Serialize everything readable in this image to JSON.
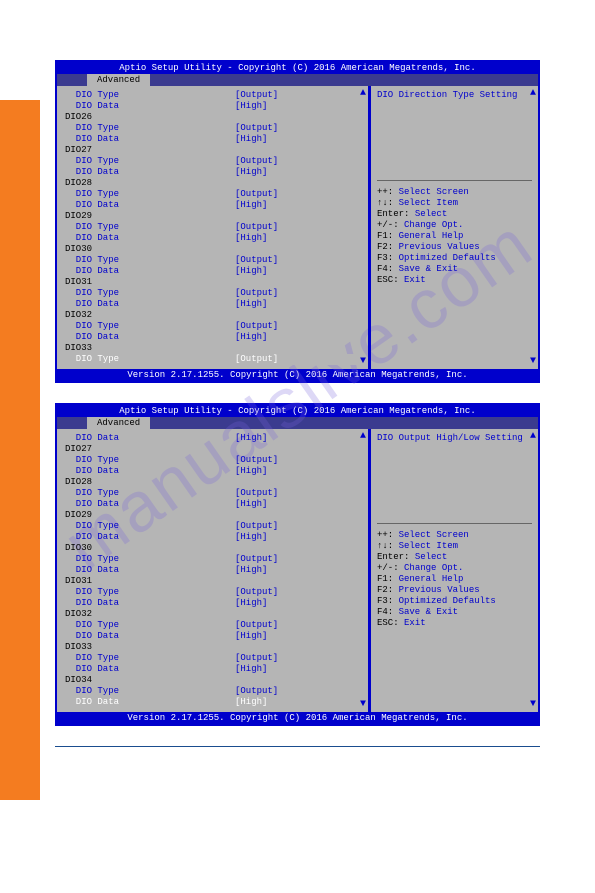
{
  "watermark": "manualslive.com",
  "title": "Aptio Setup Utility - Copyright (C) 2016 American Megatrends, Inc.",
  "tab": "Advanced",
  "footer": "Version 2.17.1255. Copyright (C) 2016 American Megatrends, Inc.",
  "panel1": {
    "help_title": "DIO Direction Type Setting",
    "rows": [
      {
        "t": "item",
        "label": "  DIO Type",
        "value": "[Output]",
        "hl": false
      },
      {
        "t": "item",
        "label": "  DIO Data",
        "value": "[High]",
        "hl": false
      },
      {
        "t": "group",
        "label": "DIO26"
      },
      {
        "t": "item",
        "label": "  DIO Type",
        "value": "[Output]",
        "hl": false
      },
      {
        "t": "item",
        "label": "  DIO Data",
        "value": "[High]",
        "hl": false
      },
      {
        "t": "group",
        "label": "DIO27"
      },
      {
        "t": "item",
        "label": "  DIO Type",
        "value": "[Output]",
        "hl": false
      },
      {
        "t": "item",
        "label": "  DIO Data",
        "value": "[High]",
        "hl": false
      },
      {
        "t": "group",
        "label": "DIO28"
      },
      {
        "t": "item",
        "label": "  DIO Type",
        "value": "[Output]",
        "hl": false
      },
      {
        "t": "item",
        "label": "  DIO Data",
        "value": "[High]",
        "hl": false
      },
      {
        "t": "group",
        "label": "DIO29"
      },
      {
        "t": "item",
        "label": "  DIO Type",
        "value": "[Output]",
        "hl": false
      },
      {
        "t": "item",
        "label": "  DIO Data",
        "value": "[High]",
        "hl": false
      },
      {
        "t": "group",
        "label": "DIO30"
      },
      {
        "t": "item",
        "label": "  DIO Type",
        "value": "[Output]",
        "hl": false
      },
      {
        "t": "item",
        "label": "  DIO Data",
        "value": "[High]",
        "hl": false
      },
      {
        "t": "group",
        "label": "DIO31"
      },
      {
        "t": "item",
        "label": "  DIO Type",
        "value": "[Output]",
        "hl": false
      },
      {
        "t": "item",
        "label": "  DIO Data",
        "value": "[High]",
        "hl": false
      },
      {
        "t": "group",
        "label": "DIO32"
      },
      {
        "t": "item",
        "label": "  DIO Type",
        "value": "[Output]",
        "hl": false
      },
      {
        "t": "item",
        "label": "  DIO Data",
        "value": "[High]",
        "hl": false
      },
      {
        "t": "group",
        "label": "DIO33"
      },
      {
        "t": "item",
        "label": "  DIO Type",
        "value": "[Output]",
        "hl": true
      }
    ]
  },
  "panel2": {
    "help_title": "DIO Output High/Low Setting",
    "rows": [
      {
        "t": "item",
        "label": "  DIO Data",
        "value": "[High]",
        "hl": false
      },
      {
        "t": "group",
        "label": "DIO27"
      },
      {
        "t": "item",
        "label": "  DIO Type",
        "value": "[Output]",
        "hl": false
      },
      {
        "t": "item",
        "label": "  DIO Data",
        "value": "[High]",
        "hl": false
      },
      {
        "t": "group",
        "label": "DIO28"
      },
      {
        "t": "item",
        "label": "  DIO Type",
        "value": "[Output]",
        "hl": false
      },
      {
        "t": "item",
        "label": "  DIO Data",
        "value": "[High]",
        "hl": false
      },
      {
        "t": "group",
        "label": "DIO29"
      },
      {
        "t": "item",
        "label": "  DIO Type",
        "value": "[Output]",
        "hl": false
      },
      {
        "t": "item",
        "label": "  DIO Data",
        "value": "[High]",
        "hl": false
      },
      {
        "t": "group",
        "label": "DIO30"
      },
      {
        "t": "item",
        "label": "  DIO Type",
        "value": "[Output]",
        "hl": false
      },
      {
        "t": "item",
        "label": "  DIO Data",
        "value": "[High]",
        "hl": false
      },
      {
        "t": "group",
        "label": "DIO31"
      },
      {
        "t": "item",
        "label": "  DIO Type",
        "value": "[Output]",
        "hl": false
      },
      {
        "t": "item",
        "label": "  DIO Data",
        "value": "[High]",
        "hl": false
      },
      {
        "t": "group",
        "label": "DIO32"
      },
      {
        "t": "item",
        "label": "  DIO Type",
        "value": "[Output]",
        "hl": false
      },
      {
        "t": "item",
        "label": "  DIO Data",
        "value": "[High]",
        "hl": false
      },
      {
        "t": "group",
        "label": "DIO33"
      },
      {
        "t": "item",
        "label": "  DIO Type",
        "value": "[Output]",
        "hl": false
      },
      {
        "t": "item",
        "label": "  DIO Data",
        "value": "[High]",
        "hl": false
      },
      {
        "t": "group",
        "label": "DIO34"
      },
      {
        "t": "item",
        "label": "  DIO Type",
        "value": "[Output]",
        "hl": false
      },
      {
        "t": "item",
        "label": "  DIO Data",
        "value": "[High]",
        "hl": true
      }
    ]
  },
  "help_keys": [
    {
      "k": "++: ",
      "d": "Select Screen"
    },
    {
      "k": "↑↓: ",
      "d": "Select Item"
    },
    {
      "k": "Enter: ",
      "d": "Select"
    },
    {
      "k": "+/-: ",
      "d": "Change Opt."
    },
    {
      "k": "F1: ",
      "d": "General Help"
    },
    {
      "k": "F2: ",
      "d": "Previous Values"
    },
    {
      "k": "F3: ",
      "d": "Optimized Defaults"
    },
    {
      "k": "F4: ",
      "d": "Save & Exit"
    },
    {
      "k": "ESC: ",
      "d": "Exit"
    }
  ]
}
